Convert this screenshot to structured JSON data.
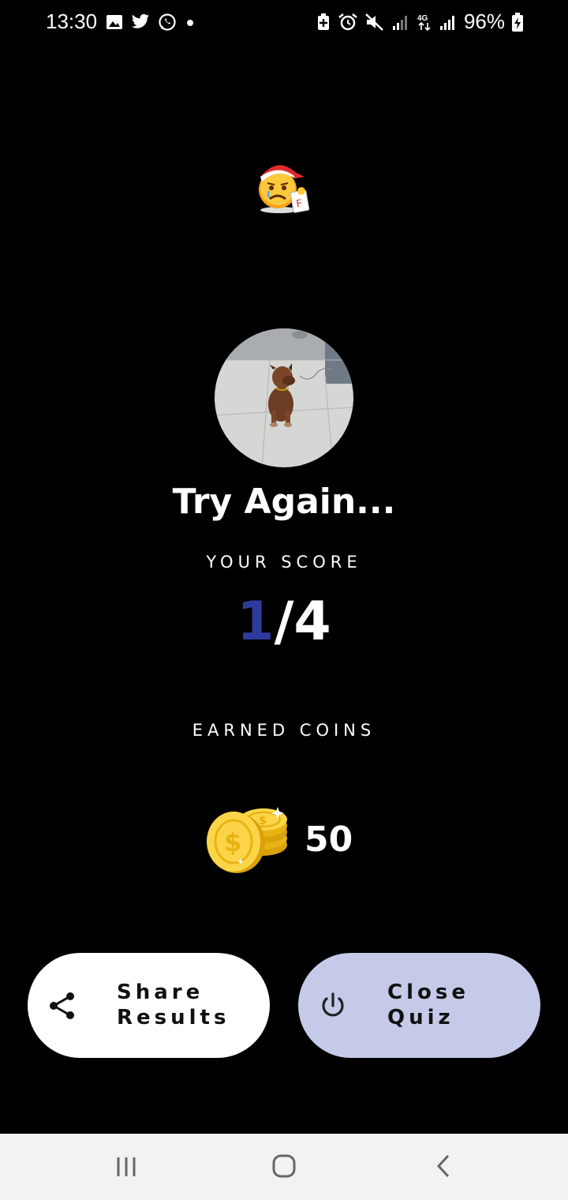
{
  "status_bar": {
    "time": "13:30",
    "left_icons": [
      "gallery-icon",
      "twitter-icon",
      "whatsapp-icon",
      "dot-icon"
    ],
    "right_icons": [
      "battery-saver-icon",
      "alarm-icon",
      "mute-icon",
      "signal-icon",
      "4g-icon",
      "signal-icon",
      "battery-charging-icon"
    ],
    "battery": "96%"
  },
  "result": {
    "title": "Try Again...",
    "score_label": "YOUR SCORE",
    "score_got": "1",
    "score_sep": "/",
    "score_total": "4",
    "coins_label": "EARNED COINS",
    "coins": "50"
  },
  "buttons": {
    "share": {
      "line1": "Share",
      "line2": "Results",
      "icon": "share-icon"
    },
    "close": {
      "line1": "Close",
      "line2": "Quiz",
      "icon": "power-icon"
    }
  },
  "colors": {
    "background": "#000000",
    "score_accent": "#2e3a9c",
    "close_button": "#c5cae9",
    "share_button": "#ffffff",
    "nav_bar": "#f2f2f2"
  },
  "nav_bar": {
    "items": [
      "recents-icon",
      "home-icon",
      "back-icon"
    ]
  }
}
